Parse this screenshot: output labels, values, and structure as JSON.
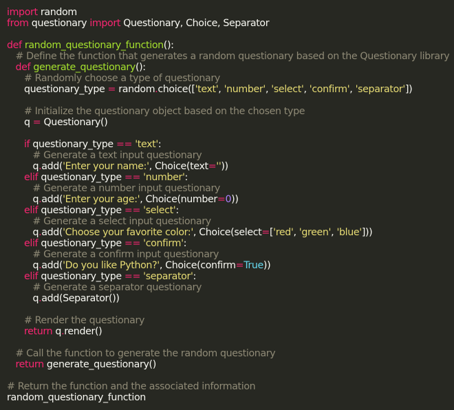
{
  "code": {
    "language": "python",
    "theme_colors": {
      "background": "#272822",
      "text": "#f8f8f2",
      "keyword": "#f92672",
      "function_name": "#a6e22e",
      "string": "#e6db74",
      "comment": "#8f8a76",
      "number": "#ae81ff",
      "constant": "#66d9ef"
    },
    "lines": [
      [
        {
          "t": "import",
          "c": "kw"
        },
        {
          "t": " random"
        }
      ],
      [
        {
          "t": "from",
          "c": "kw"
        },
        {
          "t": " questionary "
        },
        {
          "t": "import",
          "c": "kw"
        },
        {
          "t": " Questionary, Choice, Separator"
        }
      ],
      [],
      [
        {
          "t": "def",
          "c": "kw"
        },
        {
          "t": " "
        },
        {
          "t": "random_questionary_function",
          "c": "fn"
        },
        {
          "t": "():"
        }
      ],
      [
        {
          "t": "   "
        },
        {
          "t": "# Define the function that generates a random questionary based on the Questionary library",
          "c": "cm"
        }
      ],
      [
        {
          "t": "   "
        },
        {
          "t": "def",
          "c": "kw"
        },
        {
          "t": " "
        },
        {
          "t": "generate_questionary",
          "c": "fn"
        },
        {
          "t": "():"
        }
      ],
      [
        {
          "t": "      "
        },
        {
          "t": "# Randomly choose a type of questionary",
          "c": "cm"
        }
      ],
      [
        {
          "t": "      questionary_type "
        },
        {
          "t": "=",
          "c": "kw"
        },
        {
          "t": " random"
        },
        {
          "t": ".",
          "c": "kw"
        },
        {
          "t": "choice(["
        },
        {
          "t": "'text'",
          "c": "st"
        },
        {
          "t": ", "
        },
        {
          "t": "'number'",
          "c": "st"
        },
        {
          "t": ", "
        },
        {
          "t": "'select'",
          "c": "st"
        },
        {
          "t": ", "
        },
        {
          "t": "'confirm'",
          "c": "st"
        },
        {
          "t": ", "
        },
        {
          "t": "'separator'",
          "c": "st"
        },
        {
          "t": "])"
        }
      ],
      [],
      [
        {
          "t": "      "
        },
        {
          "t": "# Initialize the questionary object based on the chosen type",
          "c": "cm"
        }
      ],
      [
        {
          "t": "      q "
        },
        {
          "t": "=",
          "c": "kw"
        },
        {
          "t": " Questionary()"
        }
      ],
      [],
      [
        {
          "t": "      "
        },
        {
          "t": "if",
          "c": "kw"
        },
        {
          "t": " questionary_type "
        },
        {
          "t": "==",
          "c": "kw"
        },
        {
          "t": " "
        },
        {
          "t": "'text'",
          "c": "st"
        },
        {
          "t": ":"
        }
      ],
      [
        {
          "t": "         "
        },
        {
          "t": "# Generate a text input questionary",
          "c": "cm"
        }
      ],
      [
        {
          "t": "         q"
        },
        {
          "t": ".",
          "c": "kw"
        },
        {
          "t": "add("
        },
        {
          "t": "'Enter your name:'",
          "c": "st"
        },
        {
          "t": ", Choice(text"
        },
        {
          "t": "=",
          "c": "kw"
        },
        {
          "t": "''",
          "c": "st"
        },
        {
          "t": "))"
        }
      ],
      [
        {
          "t": "      "
        },
        {
          "t": "elif",
          "c": "kw"
        },
        {
          "t": " questionary_type "
        },
        {
          "t": "==",
          "c": "kw"
        },
        {
          "t": " "
        },
        {
          "t": "'number'",
          "c": "st"
        },
        {
          "t": ":"
        }
      ],
      [
        {
          "t": "         "
        },
        {
          "t": "# Generate a number input questionary",
          "c": "cm"
        }
      ],
      [
        {
          "t": "         q"
        },
        {
          "t": ".",
          "c": "kw"
        },
        {
          "t": "add("
        },
        {
          "t": "'Enter your age:'",
          "c": "st"
        },
        {
          "t": ", Choice(number"
        },
        {
          "t": "=",
          "c": "kw"
        },
        {
          "t": "0",
          "c": "nu"
        },
        {
          "t": "))"
        }
      ],
      [
        {
          "t": "      "
        },
        {
          "t": "elif",
          "c": "kw"
        },
        {
          "t": " questionary_type "
        },
        {
          "t": "==",
          "c": "kw"
        },
        {
          "t": " "
        },
        {
          "t": "'select'",
          "c": "st"
        },
        {
          "t": ":"
        }
      ],
      [
        {
          "t": "         "
        },
        {
          "t": "# Generate a select input questionary",
          "c": "cm"
        }
      ],
      [
        {
          "t": "         q"
        },
        {
          "t": ".",
          "c": "kw"
        },
        {
          "t": "add("
        },
        {
          "t": "'Choose your favorite color:'",
          "c": "st"
        },
        {
          "t": ", Choice(select"
        },
        {
          "t": "=",
          "c": "kw"
        },
        {
          "t": "["
        },
        {
          "t": "'red'",
          "c": "st"
        },
        {
          "t": ", "
        },
        {
          "t": "'green'",
          "c": "st"
        },
        {
          "t": ", "
        },
        {
          "t": "'blue'",
          "c": "st"
        },
        {
          "t": "]))"
        }
      ],
      [
        {
          "t": "      "
        },
        {
          "t": "elif",
          "c": "kw"
        },
        {
          "t": " questionary_type "
        },
        {
          "t": "==",
          "c": "kw"
        },
        {
          "t": " "
        },
        {
          "t": "'confirm'",
          "c": "st"
        },
        {
          "t": ":"
        }
      ],
      [
        {
          "t": "         "
        },
        {
          "t": "# Generate a confirm input questionary",
          "c": "cm"
        }
      ],
      [
        {
          "t": "         q"
        },
        {
          "t": ".",
          "c": "kw"
        },
        {
          "t": "add("
        },
        {
          "t": "'Do you like Python?'",
          "c": "st"
        },
        {
          "t": ", Choice(confirm"
        },
        {
          "t": "=",
          "c": "kw"
        },
        {
          "t": "True",
          "c": "cn"
        },
        {
          "t": "))"
        }
      ],
      [
        {
          "t": "      "
        },
        {
          "t": "elif",
          "c": "kw"
        },
        {
          "t": " questionary_type "
        },
        {
          "t": "==",
          "c": "kw"
        },
        {
          "t": " "
        },
        {
          "t": "'separator'",
          "c": "st"
        },
        {
          "t": ":"
        }
      ],
      [
        {
          "t": "         "
        },
        {
          "t": "# Generate a separator questionary",
          "c": "cm"
        }
      ],
      [
        {
          "t": "         q"
        },
        {
          "t": ".",
          "c": "kw"
        },
        {
          "t": "add(Separator())"
        }
      ],
      [],
      [
        {
          "t": "      "
        },
        {
          "t": "# Render the questionary",
          "c": "cm"
        }
      ],
      [
        {
          "t": "      "
        },
        {
          "t": "return",
          "c": "kw"
        },
        {
          "t": " q"
        },
        {
          "t": ".",
          "c": "kw"
        },
        {
          "t": "render()"
        }
      ],
      [],
      [
        {
          "t": "   "
        },
        {
          "t": "# Call the function to generate the random questionary",
          "c": "cm"
        }
      ],
      [
        {
          "t": "   "
        },
        {
          "t": "return",
          "c": "kw"
        },
        {
          "t": " generate_questionary()"
        }
      ],
      [],
      [
        {
          "t": "# Return the function and the associated information",
          "c": "cm"
        }
      ],
      [
        {
          "t": "random_questionary_function"
        }
      ]
    ]
  }
}
